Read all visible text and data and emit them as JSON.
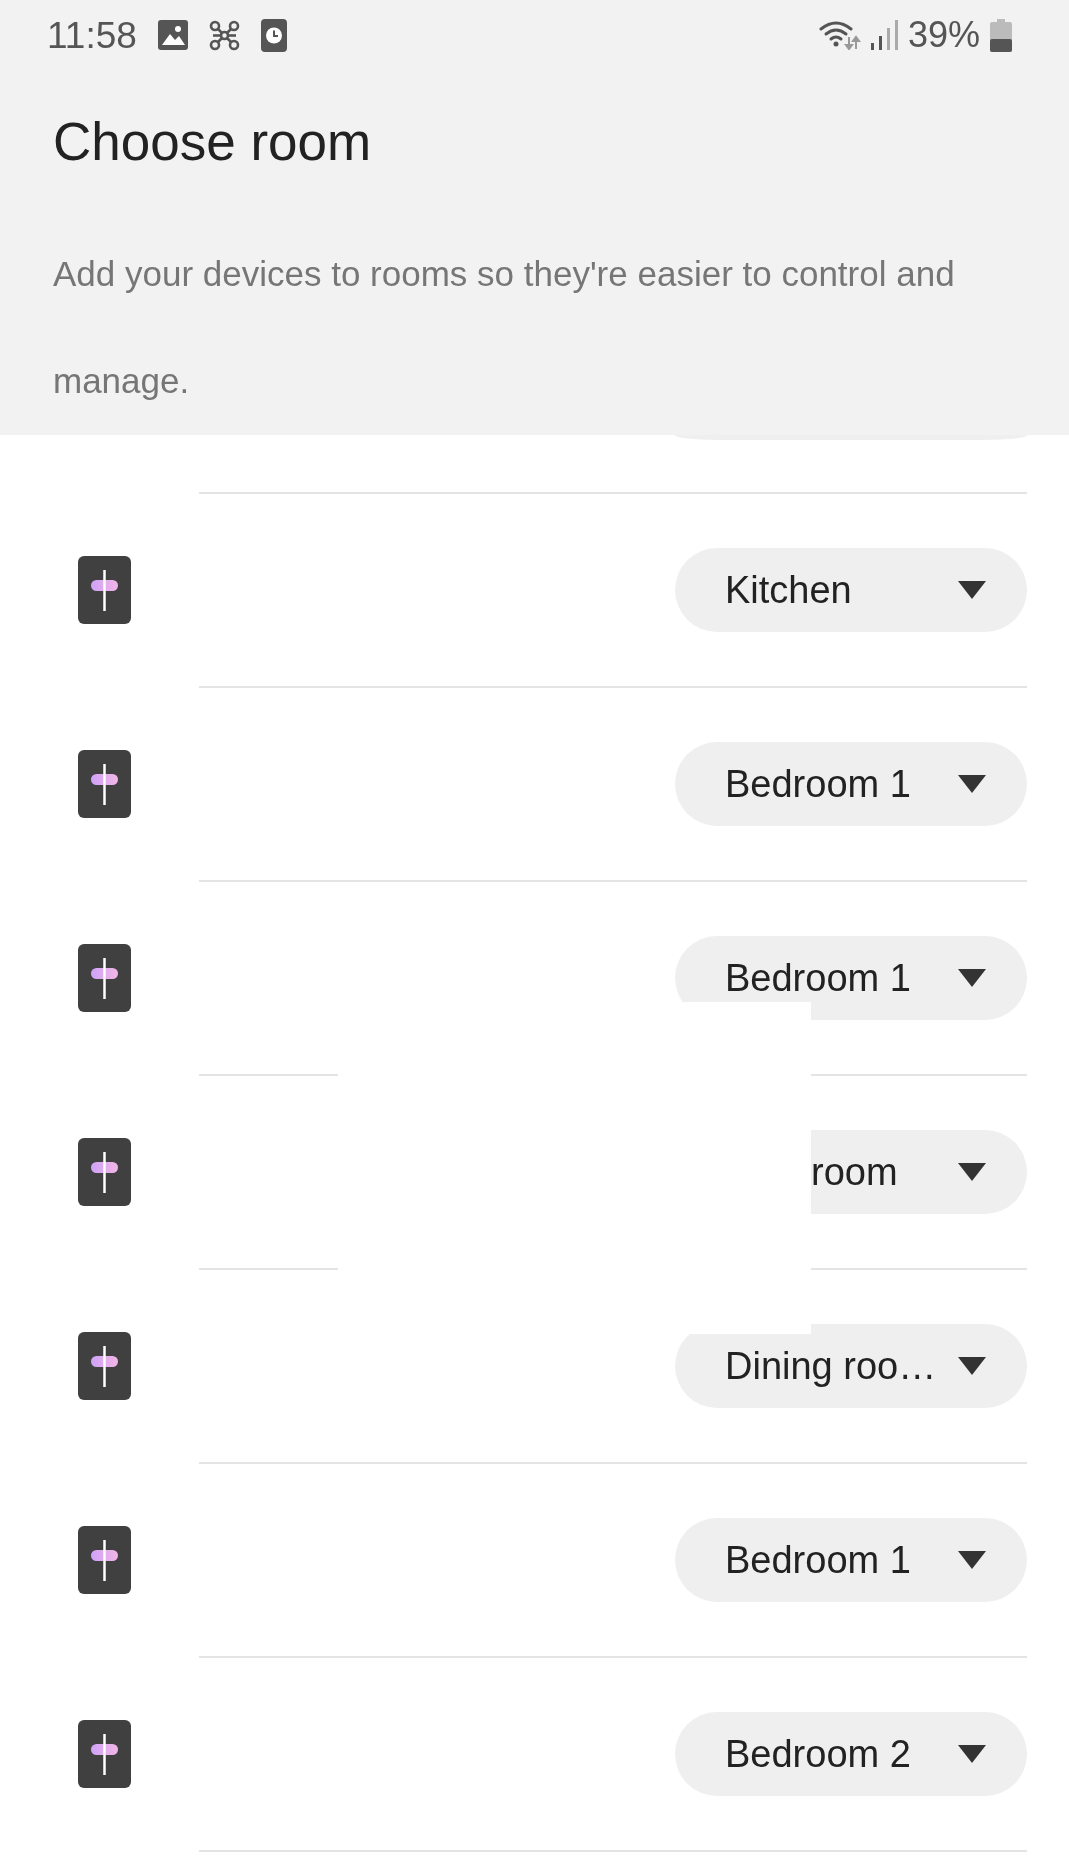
{
  "status_bar": {
    "time": "11:58",
    "battery": "39%"
  },
  "header": {
    "title": "Choose room",
    "description": "Add your devices to rooms so they're easier to control and manage."
  },
  "devices": [
    {
      "room": "Kitchen",
      "covered": false
    },
    {
      "room": "Bedroom 1",
      "covered": false
    },
    {
      "room": "Bedroom 1",
      "covered": true
    },
    {
      "room": "room",
      "covered": true
    },
    {
      "room": "Dining roo…",
      "covered": true
    },
    {
      "room": "Bedroom 1",
      "covered": false
    },
    {
      "room": "Bedroom 2",
      "covered": false
    }
  ]
}
